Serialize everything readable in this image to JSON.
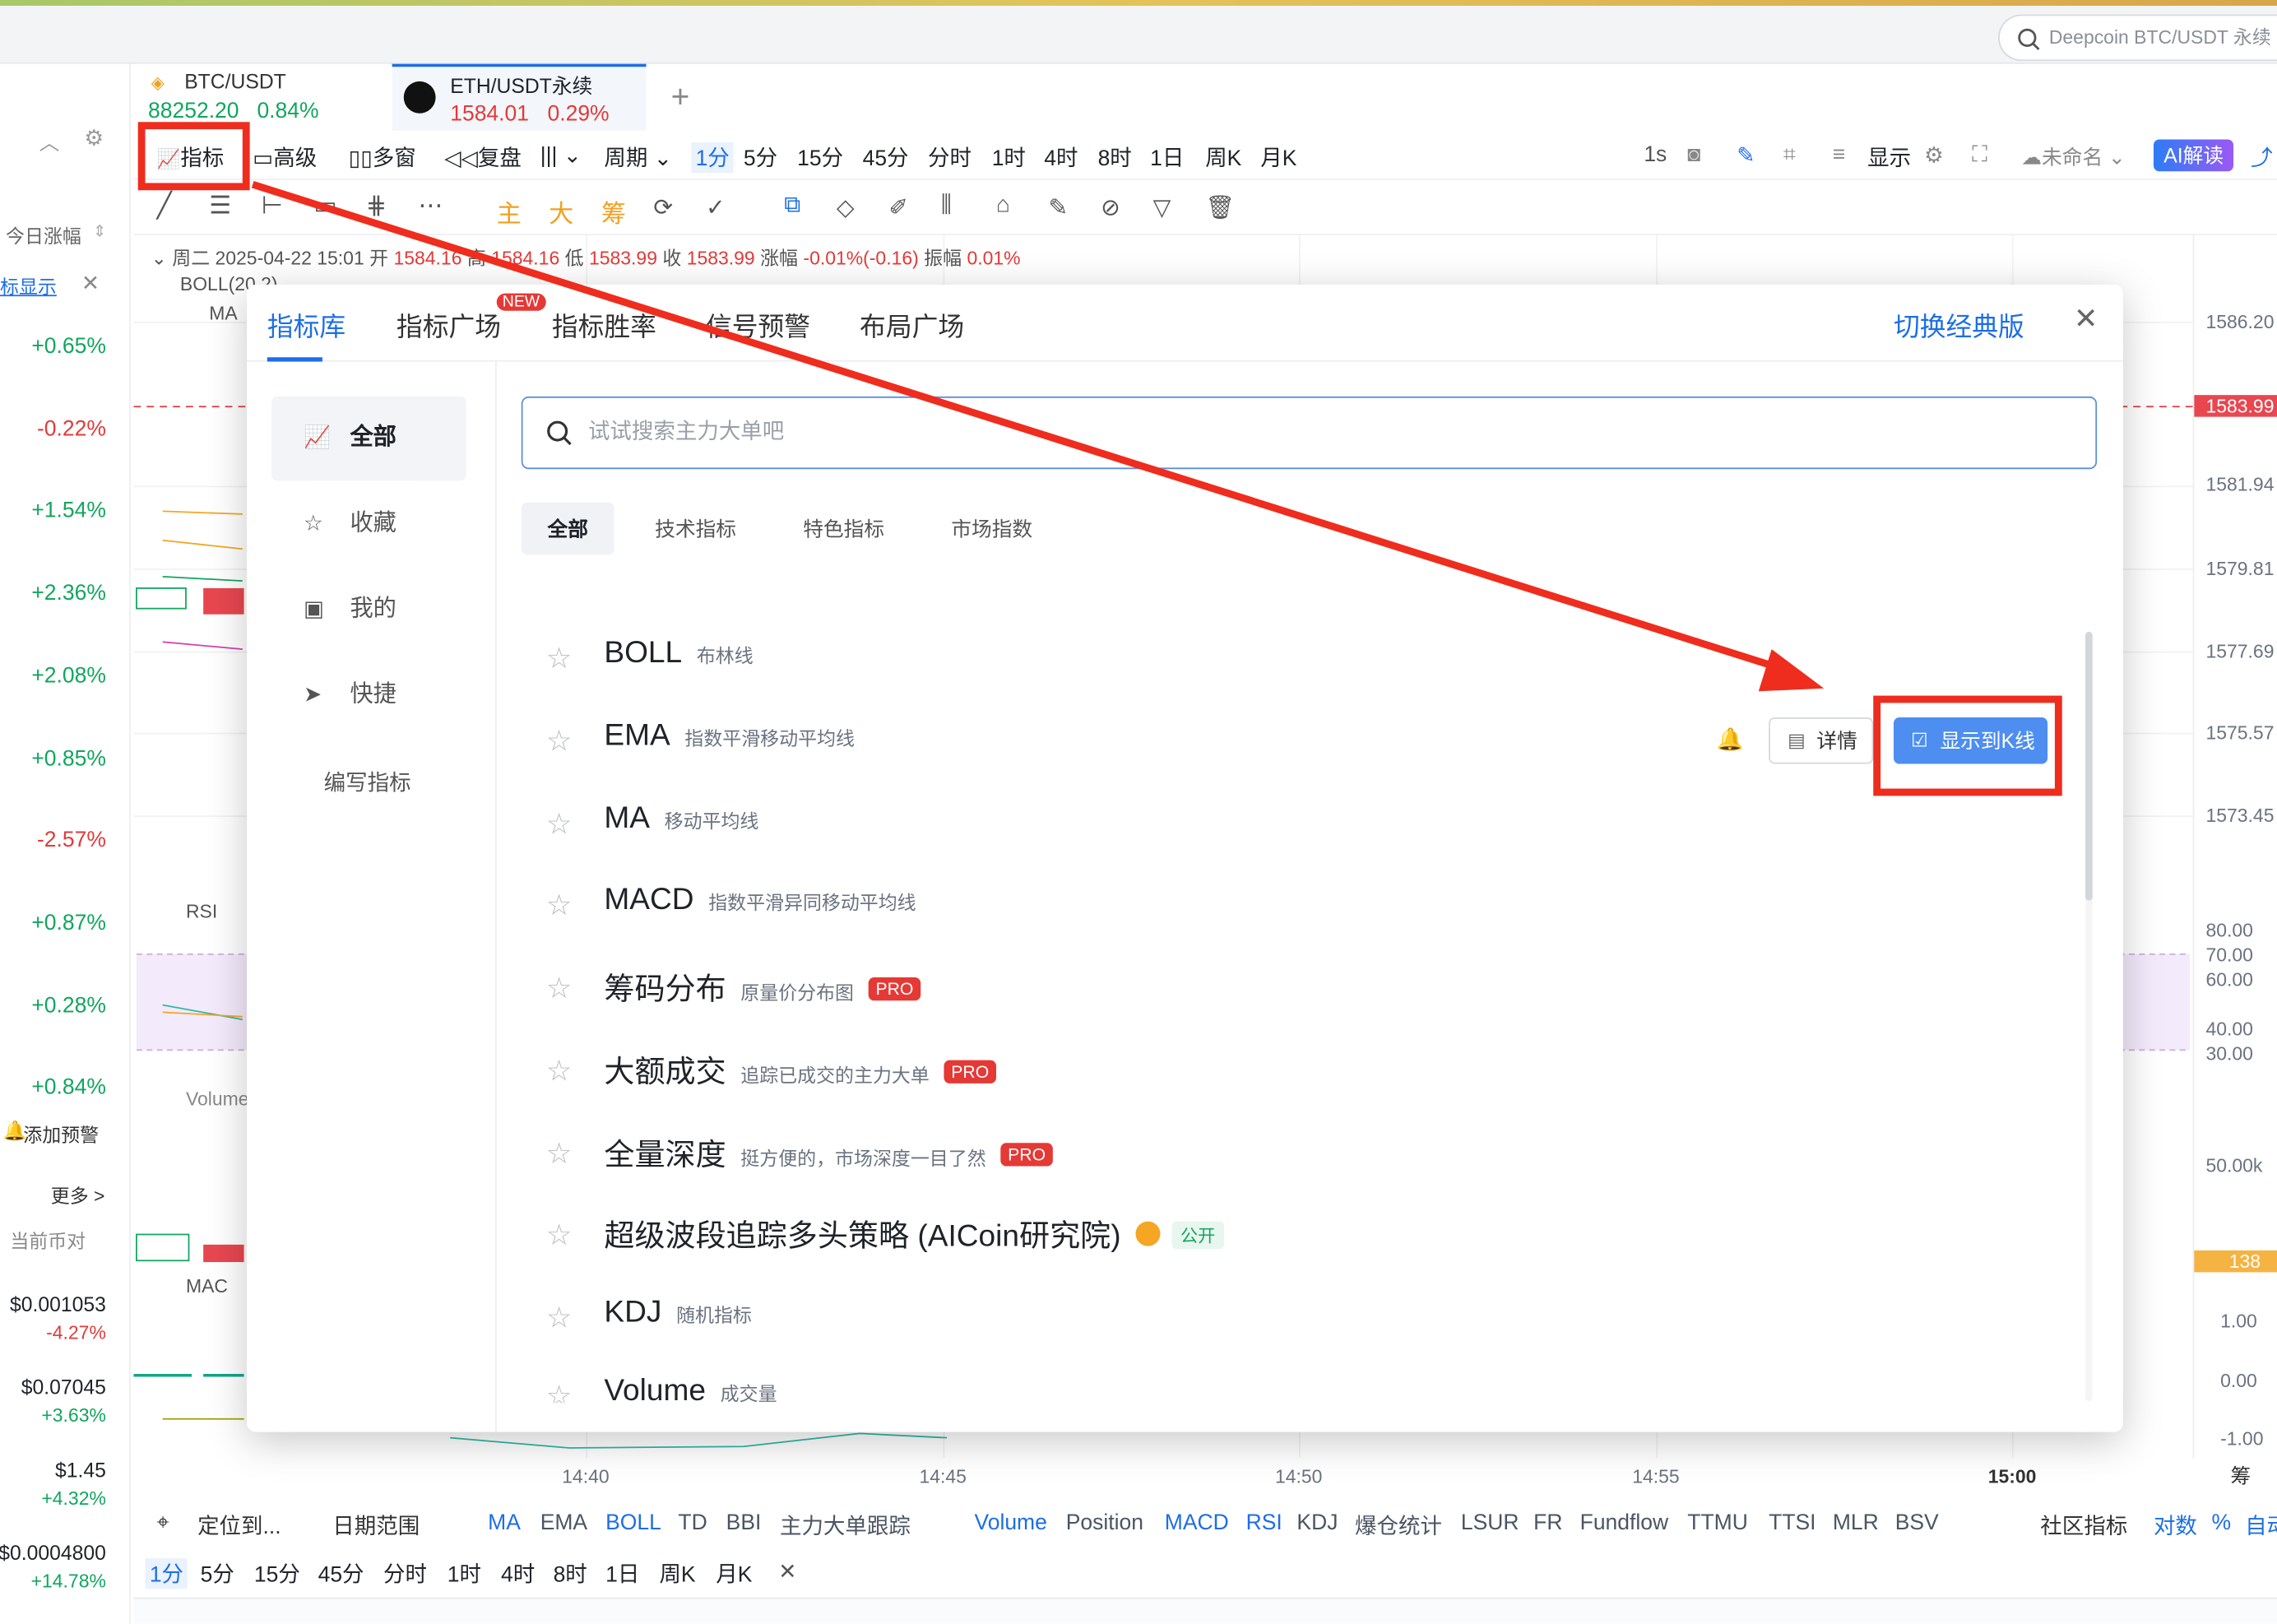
{
  "global_search": {
    "placeholder": "Deepcoin BTC/USDT 永续"
  },
  "tabs": [
    {
      "symbol": "BTC/USDT",
      "price": "88252.20",
      "change": "0.84%"
    },
    {
      "symbol": "ETH/USDT永续",
      "price": "1584.01",
      "change": "0.29%"
    }
  ],
  "toolbar": {
    "indicator": "指标",
    "advanced": "高级",
    "multiwin": "多窗",
    "replay": "复盘",
    "period": "周期",
    "timeframes": [
      "1分",
      "5分",
      "15分",
      "45分",
      "分时",
      "1时",
      "4时",
      "8时",
      "1日",
      "周K",
      "月K"
    ],
    "right": {
      "interval": "1s",
      "display": "显示",
      "unnamed": "未命名",
      "ai": "AI解读"
    }
  },
  "drawing": {
    "main": "主",
    "big": "大",
    "chips": "筹"
  },
  "left_panel": {
    "today_change": "今日涨幅",
    "indicator_display": "标显示",
    "changes": [
      "+0.65%",
      "-0.22%",
      "+1.54%",
      "+2.36%",
      "+2.08%",
      "+0.85%",
      "-2.57%",
      "+0.87%",
      "+0.28%",
      "+0.84%"
    ],
    "add_alert": "添加预警",
    "more": "更多 >",
    "current_pair": "当前币对",
    "tickers": [
      {
        "price": "$0.001053",
        "change": "-4.27%"
      },
      {
        "price": "$0.07045",
        "change": "+3.63%"
      },
      {
        "price": "$1.45",
        "change": "+4.32%"
      },
      {
        "price": "$0.0004800",
        "change": "+14.78%"
      }
    ]
  },
  "ohlc": {
    "date": "周二 2025-04-22 15:01",
    "open_label": "开",
    "open": "1584.16",
    "high_label": "高",
    "high": "1584.16",
    "low_label": "低",
    "low": "1583.99",
    "close_label": "收",
    "close": "1583.99",
    "change_label": "涨幅",
    "change": "-0.01%(-0.16)",
    "amp_label": "振幅",
    "amp": "0.01%",
    "boll": "BOLL(20,2)",
    "ma": "MA",
    "rsi": "RSI",
    "volume": "Volume",
    "macd": "MAC"
  },
  "y_axis": {
    "prices": [
      "1586.20",
      "1583.99",
      "1581.94",
      "1579.81",
      "1577.69",
      "1575.57",
      "1573.45"
    ],
    "rsi": [
      "80.00",
      "70.00",
      "60.00",
      "40.00",
      "30.00"
    ],
    "volume": [
      "50.00k",
      "138"
    ],
    "macd": [
      "1.00",
      "0.00",
      "-1.00"
    ],
    "corner": "筹"
  },
  "x_axis": [
    "14:40",
    "14:45",
    "14:50",
    "14:55",
    "15:00"
  ],
  "bottom_bar": {
    "locate": "定位到...",
    "date_range": "日期范围",
    "indicators": [
      "MA",
      "EMA",
      "BOLL",
      "TD",
      "BBI",
      "主力大单跟踪"
    ],
    "sub_indicators": [
      "Volume",
      "Position",
      "MACD",
      "RSI",
      "KDJ",
      "爆仓统计",
      "LSUR",
      "FR",
      "Fundflow",
      "TTMU",
      "TTSI",
      "MLR",
      "BSV"
    ],
    "community": "社区指标",
    "log": "对数",
    "percent": "%",
    "auto": "自动"
  },
  "bottom_timeframes": [
    "1分",
    "5分",
    "15分",
    "45分",
    "分时",
    "1时",
    "4时",
    "8时",
    "1日",
    "周K",
    "月K"
  ],
  "modal": {
    "tabs": [
      "指标库",
      "指标广场",
      "指标胜率",
      "信号预警",
      "布局广场"
    ],
    "new_badge": "NEW",
    "classic": "切换经典版",
    "sidebar": [
      "全部",
      "收藏",
      "我的",
      "快捷"
    ],
    "write": "编写指标",
    "search_placeholder": "试试搜索主力大单吧",
    "chips": [
      "全部",
      "技术指标",
      "特色指标",
      "市场指数"
    ],
    "detail": "详情",
    "show_k": "显示到K线",
    "indicators": [
      {
        "name": "BOLL",
        "desc": "布林线"
      },
      {
        "name": "EMA",
        "desc": "指数平滑移动平均线"
      },
      {
        "name": "MA",
        "desc": "移动平均线"
      },
      {
        "name": "MACD",
        "desc": "指数平滑异同移动平均线"
      },
      {
        "name": "筹码分布",
        "desc": "原量价分布图",
        "badge": "PRO"
      },
      {
        "name": "大额成交",
        "desc": "追踪已成交的主力大单",
        "badge": "PRO"
      },
      {
        "name": "全量深度",
        "desc": "挺方便的，市场深度一目了然",
        "badge": "PRO"
      },
      {
        "name": "超级波段追踪多头策略 (AICoin研究院)",
        "desc": "",
        "public": "公开"
      },
      {
        "name": "KDJ",
        "desc": "随机指标"
      },
      {
        "name": "Volume",
        "desc": "成交量"
      }
    ]
  },
  "colors": {
    "accent": "#1d6ee6",
    "up": "#12a55f",
    "down": "#e23a3a",
    "annotation": "#ee2d1e"
  }
}
